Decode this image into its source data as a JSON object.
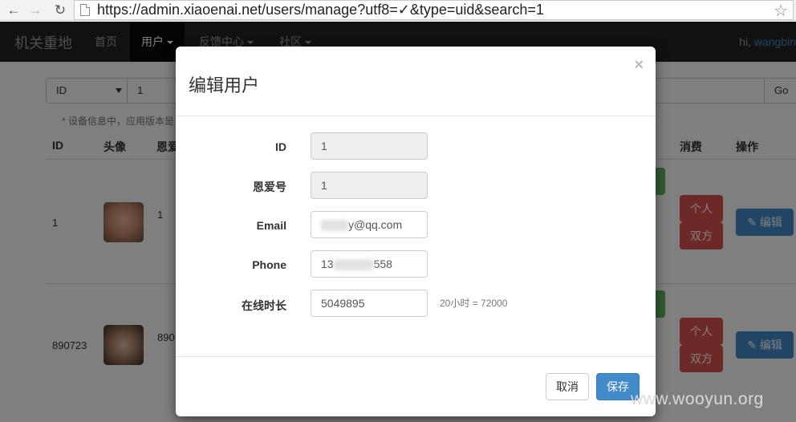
{
  "browser": {
    "url": "https://admin.xiaoenai.net/users/manage?utf8=✓&type=uid&search=1"
  },
  "navbar": {
    "brand": "机关重地",
    "items": [
      "首页",
      "用户",
      "反馈中心",
      "社区"
    ],
    "greeting_prefix": "hi, ",
    "user": "wangbin"
  },
  "search": {
    "type_value": "ID",
    "query_value": "1",
    "go_label": "Go",
    "hint": "* 设备信息中，应用版本是"
  },
  "table": {
    "headers": [
      "ID",
      "头像",
      "恩爱",
      "消费",
      "操作"
    ],
    "rows": [
      {
        "id": "1",
        "en_ai": "1",
        "btn_personal": "个人",
        "btn_both": "双方",
        "btn_edit": "编辑"
      },
      {
        "id": "890723",
        "en_ai": "890",
        "btn_personal": "个人",
        "btn_both": "双方",
        "btn_edit": "编辑"
      }
    ]
  },
  "modal": {
    "title": "编辑用户",
    "close": "×",
    "fields": [
      {
        "label": "ID",
        "value": "1"
      },
      {
        "label": "恩爱号",
        "value": "1"
      },
      {
        "label": "Email",
        "value": "y@qq.com"
      },
      {
        "label": "Phone",
        "value_prefix": "13",
        "value_suffix": "558"
      },
      {
        "label": "在线时长",
        "value": "5049895"
      }
    ],
    "help_text": "20小时 = 72000",
    "cancel_label": "取消",
    "save_label": "保存"
  },
  "watermark": "www.wooyun.org"
}
